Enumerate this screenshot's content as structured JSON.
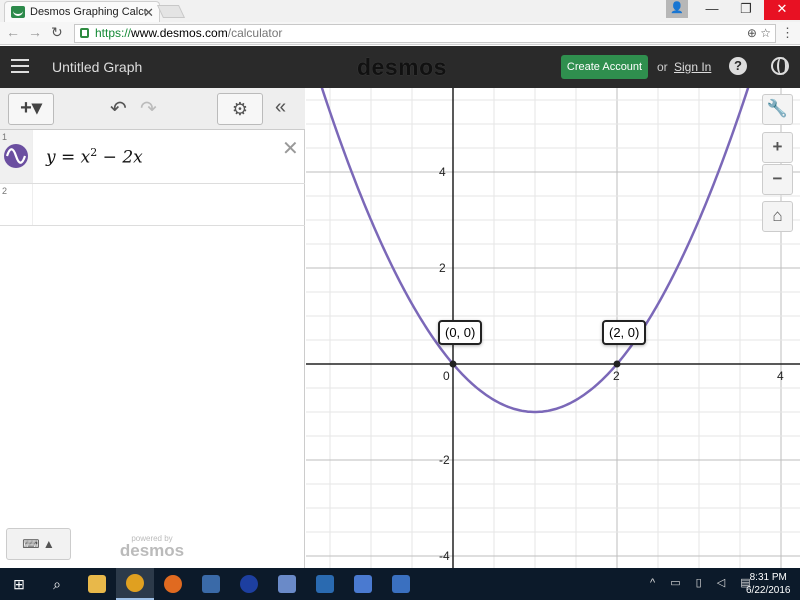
{
  "browser": {
    "tab_title": "Desmos Graphing Calcula",
    "url_scheme": "https://",
    "url_host": "www.desmos.com",
    "url_path": "/calculator"
  },
  "header": {
    "graph_title": "Untitled Graph",
    "logo": "desmos",
    "create_account": "Create Account",
    "or": "or",
    "sign_in": "Sign In",
    "help": "?"
  },
  "expressions": [
    {
      "index": "1",
      "y": "y",
      "eq": "=",
      "x": "x",
      "exp": "2",
      "rest": "− 2x"
    },
    {
      "index": "2"
    }
  ],
  "panel": {
    "powered_by": "powered by",
    "powered_logo": "desmos"
  },
  "graph": {
    "x_ticks": [
      "0",
      "2",
      "4"
    ],
    "y_ticks": [
      "4",
      "2",
      "-2",
      "-4"
    ],
    "curve_color": "#7b68b8",
    "points": [
      {
        "label": "(0, 0)",
        "x": 0,
        "y": 0
      },
      {
        "label": "(2, 0)",
        "x": 2,
        "y": 0
      }
    ]
  },
  "taskbar": {
    "time": "8:31 PM",
    "date": "6/22/2016"
  }
}
